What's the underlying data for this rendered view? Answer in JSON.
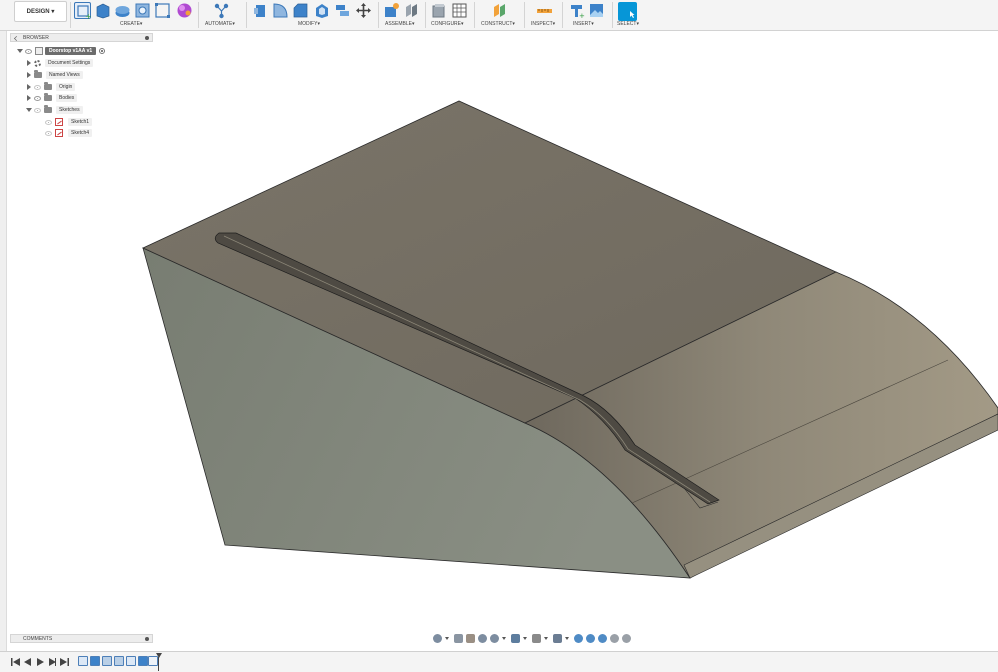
{
  "toolbar": {
    "workspace_label": "DESIGN",
    "groups": [
      {
        "label": "CREATE",
        "icons": [
          "new-sketch-icon",
          "extrude-icon",
          "revolve-icon",
          "hole-icon",
          "rectangular-pattern-icon",
          "create-form-icon"
        ]
      },
      {
        "label": "AUTOMATE",
        "icons": [
          "automate-icon"
        ]
      },
      {
        "label": "MODIFY",
        "icons": [
          "press-pull-icon",
          "fillet-icon",
          "chamfer-icon",
          "shell-icon",
          "combine-icon",
          "move-icon"
        ]
      },
      {
        "label": "ASSEMBLE",
        "icons": [
          "new-component-icon",
          "joint-icon"
        ]
      },
      {
        "label": "CONFIGURE",
        "icons": [
          "configure-icon",
          "table-icon"
        ]
      },
      {
        "label": "CONSTRUCT",
        "icons": [
          "offset-plane-icon"
        ]
      },
      {
        "label": "INSPECT",
        "icons": [
          "measure-icon"
        ]
      },
      {
        "label": "INSERT",
        "icons": [
          "insert-derive-icon",
          "insert-image-icon"
        ]
      },
      {
        "label": "SELECT",
        "icons": [
          "select-icon"
        ]
      }
    ],
    "accent_color": "#0696d7"
  },
  "browser": {
    "title": "BROWSER",
    "document_name": "Doorstop v1AA v1",
    "items": [
      {
        "label": "Document Settings",
        "icon": "gear-icon"
      },
      {
        "label": "Named Views",
        "icon": "folder-icon"
      },
      {
        "label": "Origin",
        "icon": "folder-icon"
      },
      {
        "label": "Bodies",
        "icon": "folder-icon"
      },
      {
        "label": "Sketches",
        "icon": "folder-icon"
      }
    ],
    "sketches": [
      {
        "label": "Sketch1"
      },
      {
        "label": "Sketch4"
      }
    ]
  },
  "comments": {
    "title": "COMMENTS"
  },
  "model": {
    "name": "Doorstop wedge",
    "top_color": "#7d776b",
    "side_color": "#7f8479",
    "edge_color": "#2a2a2a"
  }
}
